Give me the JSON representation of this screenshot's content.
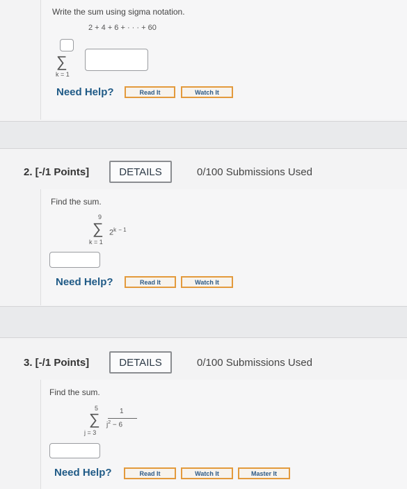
{
  "q1": {
    "prompt": "Write the sum using sigma notation.",
    "series": "2 + 4 + 6 + · · · + 60",
    "sigma_lower": "k = 1",
    "need_help": "Need Help?",
    "read_it": "Read It",
    "watch_it": "Watch It"
  },
  "q2": {
    "header": "2. [-/1 Points]",
    "details": "DETAILS",
    "submissions": "0/100 Submissions Used",
    "prompt": "Find the sum.",
    "upper": "9",
    "lower": "k = 1",
    "term_base": "2",
    "term_exp": "k",
    "term_rest": "− 1",
    "need_help": "Need Help?",
    "read_it": "Read It",
    "watch_it": "Watch It"
  },
  "q3": {
    "header": "3. [-/1 Points]",
    "details": "DETAILS",
    "submissions": "0/100 Submissions Used",
    "prompt": "Find the sum.",
    "upper": "5",
    "lower": "j = 3",
    "numerator": "1",
    "den_var": "j",
    "den_exp": "2",
    "den_rest": "− 6",
    "need_help": "Need Help?",
    "read_it": "Read It",
    "watch_it": "Watch It",
    "master_it": "Master It"
  }
}
